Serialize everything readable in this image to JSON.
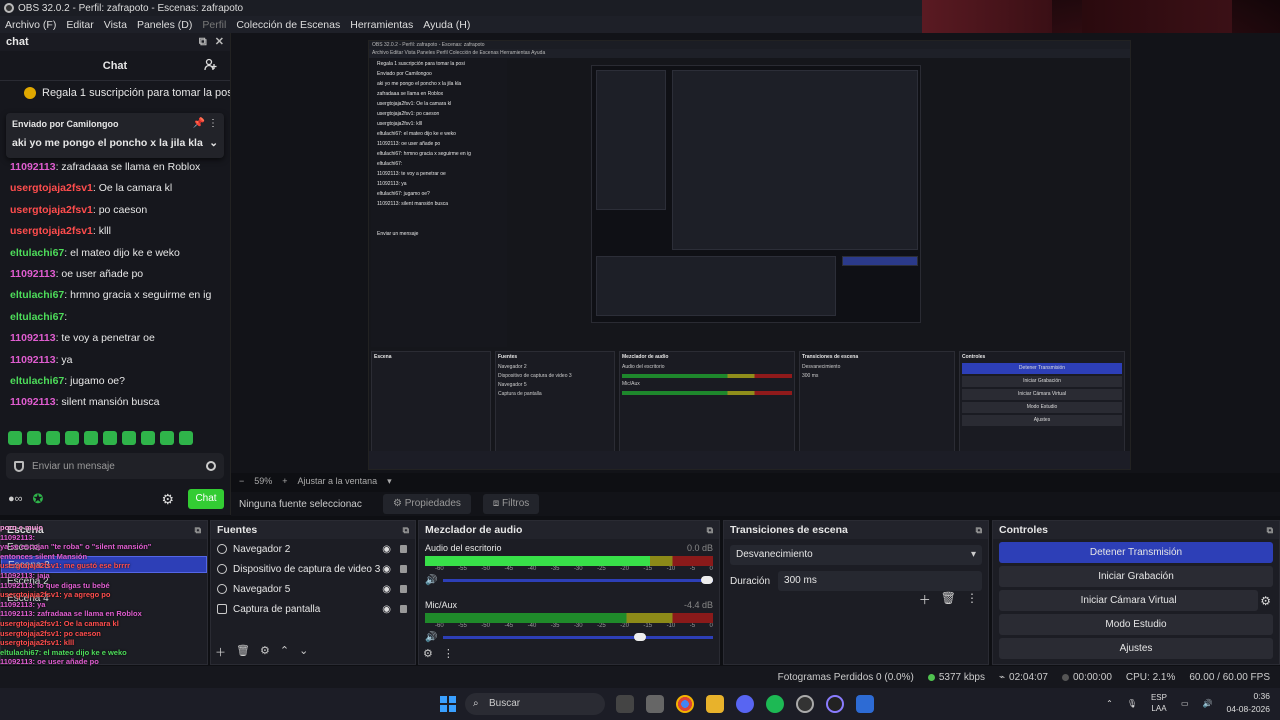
{
  "window": {
    "title": "OBS 32.0.2 - Perfil: zafrapoto - Escenas: zafrapoto"
  },
  "menu": [
    "Archivo (F)",
    "Editar",
    "Vista",
    "Paneles (D)",
    "Perfil",
    "Colección de Escenas",
    "Herramientas",
    "Ayuda (H)"
  ],
  "chat_dock": {
    "dock_title": "chat",
    "header": "Chat",
    "banner": "Regala 1 suscripción para tomar la posi",
    "pinned_by": "Enviado por Camilongoo",
    "pinned_message": "aki yo me pongo el poncho x la jila kla",
    "messages": [
      {
        "user": "11092113",
        "text": ": zafradaaa se llama en Roblox",
        "color": "#e05dd0"
      },
      {
        "user": "usergtojaja2fsv1",
        "text": ": Oe la camara kl",
        "color": "#ff4d4d"
      },
      {
        "user": "usergtojaja2fsv1",
        "text": ": po caeson",
        "color": "#ff4d4d"
      },
      {
        "user": "usergtojaja2fsv1",
        "text": ": klll",
        "color": "#ff4d4d"
      },
      {
        "user": "eltulachi67",
        "text": ": el mateo dijo ke e weko",
        "color": "#4ddc5a"
      },
      {
        "user": "11092113",
        "text": ": oe user añade po",
        "color": "#e05dd0"
      },
      {
        "user": "eltulachi67",
        "text": ": hrmno gracia x seguirme en ig",
        "color": "#4ddc5a"
      },
      {
        "user": "eltulachi67",
        "text": ":",
        "color": "#4ddc5a"
      },
      {
        "user": "11092113",
        "text": ": te voy a penetrar oe",
        "color": "#e05dd0"
      },
      {
        "user": "11092113",
        "text": ": ya",
        "color": "#e05dd0"
      },
      {
        "user": "eltulachi67",
        "text": ": jugamo oe?",
        "color": "#4ddc5a"
      },
      {
        "user": "11092113",
        "text": ": silent mansión busca",
        "color": "#e05dd0"
      }
    ],
    "input_placeholder": "Enviar un mensaje",
    "send_label": "Chat"
  },
  "preview": {
    "zoom": "59%",
    "fit_label": "Ajustar a la ventana",
    "no_source": "Ninguna fuente seleccionac",
    "properties_label": "Propiedades",
    "filters_label": "Filtros"
  },
  "docks": {
    "scenes": {
      "title": "Escena",
      "items": [
        "Escena",
        "Escena 3",
        "Escena 2",
        "Escena 4"
      ]
    },
    "scene_overlay_chat": [
      {
        "t": "porq e mujo",
        "c": "#ff9de2"
      },
      {
        "t": "11092113:",
        "c": "#e05dd0"
      },
      {
        "t": "ya se escojan \"te roba\" o \"silent mansión\"",
        "c": "#e05dd0"
      },
      {
        "t": "entonces silent Mansión",
        "c": "#e05dd0"
      },
      {
        "t": "usergtojaja2fsv1: me gustó ese brrrr",
        "c": "#ff4d4d"
      },
      {
        "t": "11092113: jaja",
        "c": "#e05dd0"
      },
      {
        "t": "11092113: lo que digas tu bebé",
        "c": "#e05dd0"
      },
      {
        "t": "usergtojaja2fsv1: ya agrego po",
        "c": "#ff4d4d"
      },
      {
        "t": "11092113: ya",
        "c": "#e05dd0"
      },
      {
        "t": "11092113: zafradaaa se llama en Roblox",
        "c": "#e05dd0"
      },
      {
        "t": "usergtojaja2fsv1: Oe la camara kl",
        "c": "#ff4d4d"
      },
      {
        "t": "usergtojaja2fsv1: po caeson",
        "c": "#ff4d4d"
      },
      {
        "t": "usergtojaja2fsv1: klll",
        "c": "#ff4d4d"
      },
      {
        "t": "eltulachi67: el mateo dijo ke e weko",
        "c": "#4ddc5a"
      },
      {
        "t": "11092113: oe user añade po",
        "c": "#e05dd0"
      },
      {
        "t": "eltulachi67: hrmno gracia x seguirme en ig",
        "c": "#4ddc5a"
      },
      {
        "t": "eltulachi67:",
        "c": "#4ddc5a"
      },
      {
        "t": "11092113: te voy a penetrar oe",
        "c": "#e05dd0"
      },
      {
        "t": "11092113: ya",
        "c": "#e05dd0"
      },
      {
        "t": "eltulachi67: jugamo oe?",
        "c": "#4ddc5a"
      },
      {
        "t": "11092113: silent mansión busca",
        "c": "#e05dd0"
      }
    ],
    "sources": {
      "title": "Fuentes",
      "items": [
        "Navegador 2",
        "Dispositivo de captura de video 3",
        "Navegador 5",
        "Captura de pantalla"
      ]
    },
    "mixer": {
      "title": "Mezclador de audio",
      "ticks": [
        "-60",
        "-55",
        "-50",
        "-45",
        "-40",
        "-35",
        "-30",
        "-25",
        "-20",
        "-15",
        "-10",
        "-5",
        "0"
      ],
      "channels": [
        {
          "name": "Audio del escritorio",
          "db": "0.0 dB",
          "level": 0.78,
          "volume": 1.0
        },
        {
          "name": "Mic/Aux",
          "db": "-4.4 dB",
          "level": 0.0,
          "volume": 0.75
        }
      ]
    },
    "transitions": {
      "title": "Transiciones de escena",
      "selected": "Desvanecimiento",
      "duration_label": "Duración",
      "duration": "300 ms"
    },
    "controls": {
      "title": "Controles",
      "buttons": [
        "Detener Transmisión",
        "Iniciar Grabación",
        "Iniciar Cámara Virtual",
        "Modo Estudio",
        "Ajustes"
      ]
    }
  },
  "status": {
    "dropped": "Fotogramas Perdidos 0 (0.0%)",
    "bitrate": "5377 kbps",
    "stream_time": "02:04:07",
    "rec_time": "00:00:00",
    "cpu": "CPU: 2.1%",
    "fps": "60.00 / 60.00 FPS"
  },
  "taskbar": {
    "search": "Buscar",
    "lang_top": "ESP",
    "lang_bottom": "LAA",
    "time": "0:36",
    "date": "04-08-2026"
  },
  "nested_preview": {
    "title": "OBS 32.0.2 - Perfil: zafrapoto - Escenas: zafrapoto",
    "menu": "Archivo  Editar  Vista  Paneles  Perfil  Colección de Escenas  Herramientas  Ayuda",
    "chat_lines": [
      "Regala 1 suscripción para tomar la posi",
      "Enviado por Camilongoo",
      "aki yo me pongo el poncho x la jila kla",
      "zafradaaa se llama en Roblox",
      "usergtojaja2fsv1: Oe la camara kl",
      "usergtojaja2fsv1: po caeson",
      "usergtojaja2fsv1: klll",
      "eltulachi67: el mateo dijo ke e weko",
      "11092113: oe user añade po",
      "eltulachi67: hrmno gracia x seguirme en ig",
      "eltulachi67:",
      "11092113: te voy a penetrar oe",
      "11092113: ya",
      "eltulachi67: jugamo oe?",
      "11092113: silent mansión busca",
      "",
      "",
      "Enviar un mensaje"
    ],
    "docks": [
      "Escena",
      "Fuentes",
      "Mezclador de audio",
      "Transiciones de escena",
      "Controles"
    ]
  },
  "colors": {
    "accent": "#2d3fb7",
    "chat_send": "#33cc33",
    "live": "#4fc24f"
  }
}
